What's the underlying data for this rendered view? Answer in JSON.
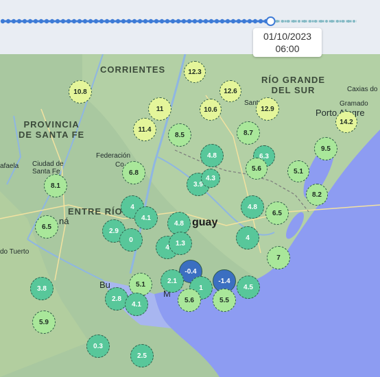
{
  "timeline": {
    "date": "01/10/2023",
    "time": "06:00",
    "position": 0.757
  },
  "colors": {
    "timeline_active": "#3e7bd6",
    "timeline_future": "#83b9c4",
    "sea": "#8d9cf2",
    "land": "#a9c8a0",
    "river": "#8fb6e2"
  },
  "map_labels": {
    "corrientes": "CORRIENTES",
    "rio_grande_del_sul": "RÍO GRANDE\nDEL SUR",
    "provincia_santa_fe": "PROVINCIA\nDE SANTA FE",
    "entre_rios": "ENTRE RÍO",
    "uruguay": "guay"
  },
  "city_labels": {
    "caxias": "Caxias do",
    "gramado": "Gramado",
    "porto_alegre": "Porto Alegre",
    "santa_maria": "Santa",
    "federacion": "Federación",
    "concordia": "Co",
    "ciudad_santa_fe": "Ciudad de\nSanta Fe",
    "rafaela": "afaela",
    "parana": "ná",
    "villa_tuerto": "do Tuerto",
    "buenos_aires": "Bu",
    "montevideo": "M"
  },
  "markers": [
    {
      "value": "12.3",
      "tone": "yellow"
    },
    {
      "value": "10.8",
      "tone": "yellow"
    },
    {
      "value": "12.6",
      "tone": "yellow"
    },
    {
      "value": "11",
      "tone": "yellow"
    },
    {
      "value": "10.6",
      "tone": "yellow"
    },
    {
      "value": "12.9",
      "tone": "yellow"
    },
    {
      "value": "14.2",
      "tone": "yellow"
    },
    {
      "value": "11.4",
      "tone": "yellow"
    },
    {
      "value": "8.5",
      "tone": "lightgreen"
    },
    {
      "value": "8.7",
      "tone": "lightgreen"
    },
    {
      "value": "9.5",
      "tone": "lightgreen"
    },
    {
      "value": "4.8",
      "tone": "green"
    },
    {
      "value": "6.3",
      "tone": "green"
    },
    {
      "value": "5.6",
      "tone": "lightgreen"
    },
    {
      "value": "6.8",
      "tone": "lightgreen"
    },
    {
      "value": "5.1",
      "tone": "lightgreen"
    },
    {
      "value": "8.2",
      "tone": "lightgreen"
    },
    {
      "value": "8.1",
      "tone": "lightgreen"
    },
    {
      "value": "3.9",
      "tone": "green"
    },
    {
      "value": "4.3",
      "tone": "green"
    },
    {
      "value": "4",
      "tone": "green"
    },
    {
      "value": "4.1",
      "tone": "green"
    },
    {
      "value": "4.8",
      "tone": "green"
    },
    {
      "value": "6.5",
      "tone": "lightgreen"
    },
    {
      "value": "4.8",
      "tone": "green"
    },
    {
      "value": "6.5",
      "tone": "lightgreen"
    },
    {
      "value": "2.9",
      "tone": "green"
    },
    {
      "value": "0",
      "tone": "green"
    },
    {
      "value": "4",
      "tone": "green"
    },
    {
      "value": "1.3",
      "tone": "green"
    },
    {
      "value": "4",
      "tone": "green"
    },
    {
      "value": "7",
      "tone": "lightgreen"
    },
    {
      "value": "-0.4",
      "tone": "blue"
    },
    {
      "value": "-1.4",
      "tone": "blue"
    },
    {
      "value": "3.8",
      "tone": "green"
    },
    {
      "value": "5.1",
      "tone": "lightgreen"
    },
    {
      "value": "2.1",
      "tone": "green"
    },
    {
      "value": "1",
      "tone": "green"
    },
    {
      "value": "4.5",
      "tone": "green"
    },
    {
      "value": "2.8",
      "tone": "green"
    },
    {
      "value": "4.1",
      "tone": "green"
    },
    {
      "value": "5.6",
      "tone": "lightgreen"
    },
    {
      "value": "5.5",
      "tone": "lightgreen"
    },
    {
      "value": "5.9",
      "tone": "lightgreen"
    },
    {
      "value": "0.3",
      "tone": "green"
    },
    {
      "value": "2.5",
      "tone": "green"
    }
  ]
}
